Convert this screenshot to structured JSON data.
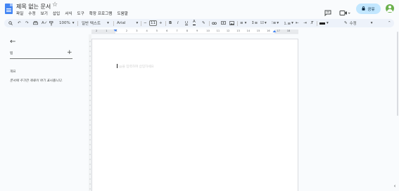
{
  "window": {
    "title": "제목 없는 문서"
  },
  "menu": [
    "파일",
    "수정",
    "보기",
    "삽입",
    "서식",
    "도구",
    "확장 프로그램",
    "도움말"
  ],
  "header": {
    "share_label": "공유"
  },
  "toolbar": {
    "zoom": "100%",
    "style": "일반 텍스트",
    "font": "Arial",
    "font_size": "11",
    "edit_mode": "수정"
  },
  "ruler": {
    "ticks": [
      "2",
      "1",
      "1",
      "2",
      "3",
      "4",
      "5",
      "6",
      "7",
      "8",
      "9",
      "10",
      "11",
      "12",
      "13",
      "14",
      "15",
      "16",
      "17",
      "18"
    ]
  },
  "sidebar": {
    "tabs_label": "탭",
    "summary_label": "개요",
    "outline_hint": "문서에 추가한 제목이 여기 표시됩니다."
  },
  "document": {
    "placeholder": "@을 입력하여 삽입하세요"
  }
}
